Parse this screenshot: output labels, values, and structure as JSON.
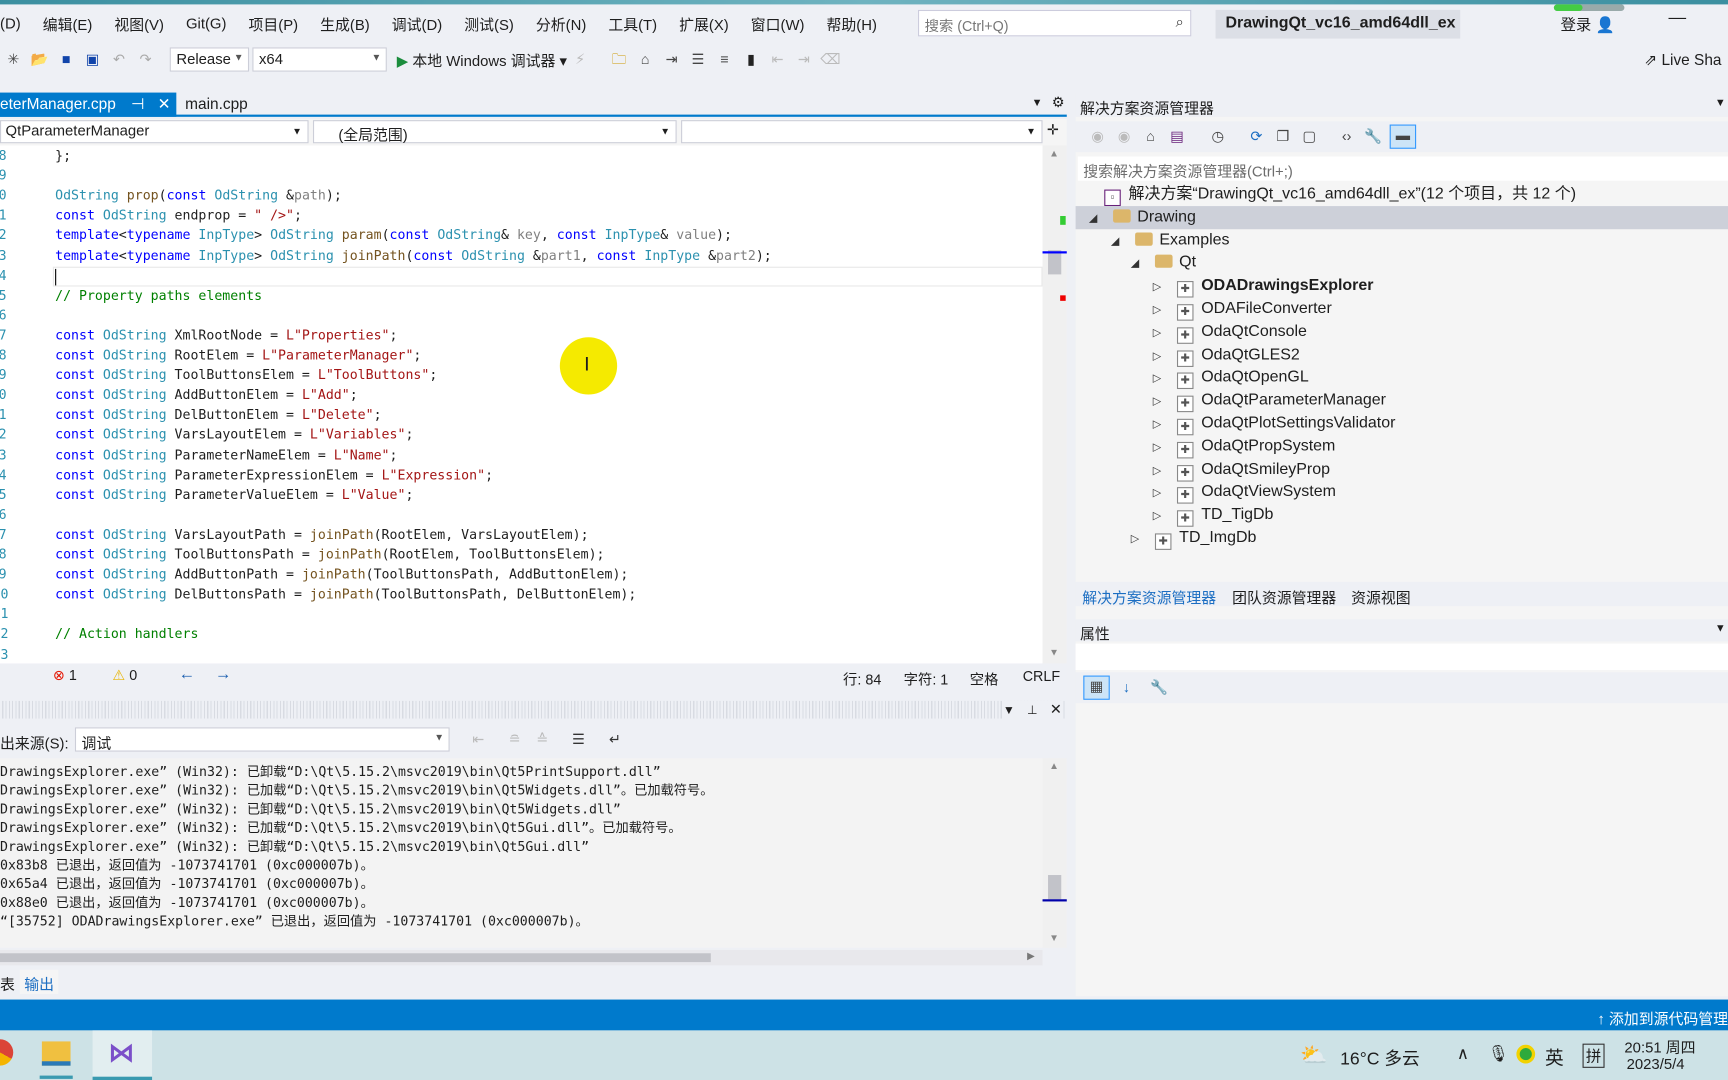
{
  "menu": [
    "(D)",
    "编辑(E)",
    "视图(V)",
    "Git(G)",
    "项目(P)",
    "生成(B)",
    "调试(D)",
    "测试(S)",
    "分析(N)",
    "工具(T)",
    "扩展(X)",
    "窗口(W)",
    "帮助(H)"
  ],
  "search": {
    "placeholder": "搜索 (Ctrl+Q)"
  },
  "window_title": "DrawingQt_vc16_amd64dll_ex",
  "login": "登录",
  "toolbar": {
    "config": "Release",
    "platform": "x64",
    "debugger": "本地 Windows 调试器",
    "live_share": "Live Sha"
  },
  "editor": {
    "tabs": [
      {
        "label": "eterManager.cpp",
        "active": true
      },
      {
        "label": "main.cpp"
      }
    ],
    "nav": {
      "class": "QtParameterManager",
      "scope": "(全局范围)",
      "member": ""
    },
    "first_line": 78,
    "lines": [
      [
        [
          "};",
          ""
        ]
      ],
      [],
      [
        [
          "OdString",
          "ty"
        ],
        [
          " ",
          ""
        ],
        [
          "prop",
          "fn"
        ],
        [
          "(",
          ""
        ],
        [
          "const",
          "kw"
        ],
        [
          " ",
          ""
        ],
        [
          "OdString",
          "ty"
        ],
        [
          " &",
          ""
        ],
        [
          "path",
          "pm"
        ],
        [
          ");",
          ""
        ]
      ],
      [
        [
          "const",
          "kw"
        ],
        [
          " ",
          ""
        ],
        [
          "OdString",
          "ty"
        ],
        [
          " endprop = ",
          ""
        ],
        [
          "\" />\"",
          "st"
        ],
        [
          ";",
          ""
        ]
      ],
      [
        [
          "template",
          "kw"
        ],
        [
          "<",
          ""
        ],
        [
          "typename",
          "kw"
        ],
        [
          " ",
          ""
        ],
        [
          "InpType",
          "ty"
        ],
        [
          "> ",
          ""
        ],
        [
          "OdString",
          "ty"
        ],
        [
          " ",
          ""
        ],
        [
          "param",
          "fn"
        ],
        [
          "(",
          ""
        ],
        [
          "const",
          "kw"
        ],
        [
          " ",
          ""
        ],
        [
          "OdString",
          "ty"
        ],
        [
          "& ",
          ""
        ],
        [
          "key",
          "pm"
        ],
        [
          ", ",
          ""
        ],
        [
          "const",
          "kw"
        ],
        [
          " ",
          ""
        ],
        [
          "InpType",
          "ty"
        ],
        [
          "& ",
          ""
        ],
        [
          "value",
          "pm"
        ],
        [
          ");",
          ""
        ]
      ],
      [
        [
          "template",
          "kw"
        ],
        [
          "<",
          ""
        ],
        [
          "typename",
          "kw"
        ],
        [
          " ",
          ""
        ],
        [
          "InpType",
          "ty"
        ],
        [
          "> ",
          ""
        ],
        [
          "OdString",
          "ty"
        ],
        [
          " ",
          ""
        ],
        [
          "joinPath",
          "fn"
        ],
        [
          "(",
          ""
        ],
        [
          "const",
          "kw"
        ],
        [
          " ",
          ""
        ],
        [
          "OdString",
          "ty"
        ],
        [
          " &",
          ""
        ],
        [
          "part1",
          "pm"
        ],
        [
          ", ",
          ""
        ],
        [
          "const",
          "kw"
        ],
        [
          " ",
          ""
        ],
        [
          "InpType",
          "ty"
        ],
        [
          " &",
          ""
        ],
        [
          "part2",
          "pm"
        ],
        [
          ");",
          ""
        ]
      ],
      [],
      [
        [
          "// Property paths elements",
          "cm"
        ]
      ],
      [],
      [
        [
          "const",
          "kw"
        ],
        [
          " ",
          ""
        ],
        [
          "OdString",
          "ty"
        ],
        [
          " XmlRootNode = ",
          ""
        ],
        [
          "L\"Properties\"",
          "st"
        ],
        [
          ";",
          ""
        ]
      ],
      [
        [
          "const",
          "kw"
        ],
        [
          " ",
          ""
        ],
        [
          "OdString",
          "ty"
        ],
        [
          " RootElem = ",
          ""
        ],
        [
          "L\"ParameterManager\"",
          "st"
        ],
        [
          ";",
          ""
        ]
      ],
      [
        [
          "const",
          "kw"
        ],
        [
          " ",
          ""
        ],
        [
          "OdString",
          "ty"
        ],
        [
          " ToolButtonsElem = ",
          ""
        ],
        [
          "L\"ToolButtons\"",
          "st"
        ],
        [
          ";",
          ""
        ]
      ],
      [
        [
          "const",
          "kw"
        ],
        [
          " ",
          ""
        ],
        [
          "OdString",
          "ty"
        ],
        [
          " AddButtonElem = ",
          ""
        ],
        [
          "L\"Add\"",
          "st"
        ],
        [
          ";",
          ""
        ]
      ],
      [
        [
          "const",
          "kw"
        ],
        [
          " ",
          ""
        ],
        [
          "OdString",
          "ty"
        ],
        [
          " DelButtonElem = ",
          ""
        ],
        [
          "L\"Delete\"",
          "st"
        ],
        [
          ";",
          ""
        ]
      ],
      [
        [
          "const",
          "kw"
        ],
        [
          " ",
          ""
        ],
        [
          "OdString",
          "ty"
        ],
        [
          " VarsLayoutElem = ",
          ""
        ],
        [
          "L\"Variables\"",
          "st"
        ],
        [
          ";",
          ""
        ]
      ],
      [
        [
          "const",
          "kw"
        ],
        [
          " ",
          ""
        ],
        [
          "OdString",
          "ty"
        ],
        [
          " ParameterNameElem = ",
          ""
        ],
        [
          "L\"Name\"",
          "st"
        ],
        [
          ";",
          ""
        ]
      ],
      [
        [
          "const",
          "kw"
        ],
        [
          " ",
          ""
        ],
        [
          "OdString",
          "ty"
        ],
        [
          " ParameterExpressionElem = ",
          ""
        ],
        [
          "L\"Expression\"",
          "st"
        ],
        [
          ";",
          ""
        ]
      ],
      [
        [
          "const",
          "kw"
        ],
        [
          " ",
          ""
        ],
        [
          "OdString",
          "ty"
        ],
        [
          " ParameterValueElem = ",
          ""
        ],
        [
          "L\"Value\"",
          "st"
        ],
        [
          ";",
          ""
        ]
      ],
      [],
      [
        [
          "const",
          "kw"
        ],
        [
          " ",
          ""
        ],
        [
          "OdString",
          "ty"
        ],
        [
          " VarsLayoutPath = ",
          ""
        ],
        [
          "joinPath",
          "fn"
        ],
        [
          "(RootElem, VarsLayoutElem);",
          ""
        ]
      ],
      [
        [
          "const",
          "kw"
        ],
        [
          " ",
          ""
        ],
        [
          "OdString",
          "ty"
        ],
        [
          " ToolButtonsPath = ",
          ""
        ],
        [
          "joinPath",
          "fn"
        ],
        [
          "(RootElem, ToolButtonsElem);",
          ""
        ]
      ],
      [
        [
          "const",
          "kw"
        ],
        [
          " ",
          ""
        ],
        [
          "OdString",
          "ty"
        ],
        [
          " AddButtonPath = ",
          ""
        ],
        [
          "joinPath",
          "fn"
        ],
        [
          "(ToolButtonsPath, AddButtonElem);",
          ""
        ]
      ],
      [
        [
          "const",
          "kw"
        ],
        [
          " ",
          ""
        ],
        [
          "OdString",
          "ty"
        ],
        [
          " DelButtonsPath = ",
          ""
        ],
        [
          "joinPath",
          "fn"
        ],
        [
          "(ToolButtonsPath, DelButtonElem);",
          ""
        ]
      ],
      [],
      [
        [
          "// Action handlers",
          "cm"
        ]
      ],
      []
    ],
    "status": {
      "errors": "1",
      "warnings": "0",
      "line": "行: 84",
      "col": "字符: 1",
      "spaces": "空格",
      "eol": "CRLF"
    }
  },
  "output": {
    "source_label": "出来源(S):",
    "source": "调试",
    "lines": [
      "DrawingsExplorer.exe” (Win32): 已卸载“D:\\Qt\\5.15.2\\msvc2019\\bin\\Qt5PrintSupport.dll”",
      "DrawingsExplorer.exe” (Win32): 已加载“D:\\Qt\\5.15.2\\msvc2019\\bin\\Qt5Widgets.dll”。已加载符号。",
      "DrawingsExplorer.exe” (Win32): 已卸载“D:\\Qt\\5.15.2\\msvc2019\\bin\\Qt5Widgets.dll”",
      "DrawingsExplorer.exe” (Win32): 已加载“D:\\Qt\\5.15.2\\msvc2019\\bin\\Qt5Gui.dll”。已加载符号。",
      "DrawingsExplorer.exe” (Win32): 已卸载“D:\\Qt\\5.15.2\\msvc2019\\bin\\Qt5Gui.dll”",
      "0x83b8 已退出，返回值为 -1073741701 (0xc000007b)。",
      "0x65a4 已退出，返回值为 -1073741701 (0xc000007b)。",
      "0x88e0 已退出，返回值为 -1073741701 (0xc000007b)。",
      "“[35752] ODADrawingsExplorer.exe” 已退出，返回值为 -1073741701 (0xc000007b)。"
    ],
    "tabs": [
      "表",
      "输出"
    ]
  },
  "solution": {
    "title": "解决方案资源管理器",
    "search_placeholder": "搜索解决方案资源管理器(Ctrl+;)",
    "root": "解决方案“DrawingQt_vc16_amd64dll_ex”(12 个项目，共 12 个)",
    "folders": [
      "Drawing",
      "Examples",
      "Qt"
    ],
    "projects": [
      "ODADrawingsExplorer",
      "ODAFileConverter",
      "OdaQtConsole",
      "OdaQtGLES2",
      "OdaQtOpenGL",
      "OdaQtParameterManager",
      "OdaQtPlotSettingsValidator",
      "OdaQtPropSystem",
      "OdaQtSmileyProp",
      "OdaQtViewSystem",
      "TD_TigDb"
    ],
    "extra_project": "TD_ImgDb",
    "tabs": [
      "解决方案资源管理器",
      "团队资源管理器",
      "资源视图"
    ],
    "properties_title": "属性"
  },
  "statusbar": {
    "source_control": "添加到源代码管理"
  },
  "taskbar": {
    "weather": "16°C 多云",
    "ime": "英",
    "ime2": "拼",
    "time": "20:51 周四",
    "date": "2023/5/4"
  },
  "colors": {
    "accent": "#007acc",
    "keyword": "#0000ff",
    "type": "#2b91af",
    "string": "#a31515",
    "comment": "#008000"
  }
}
